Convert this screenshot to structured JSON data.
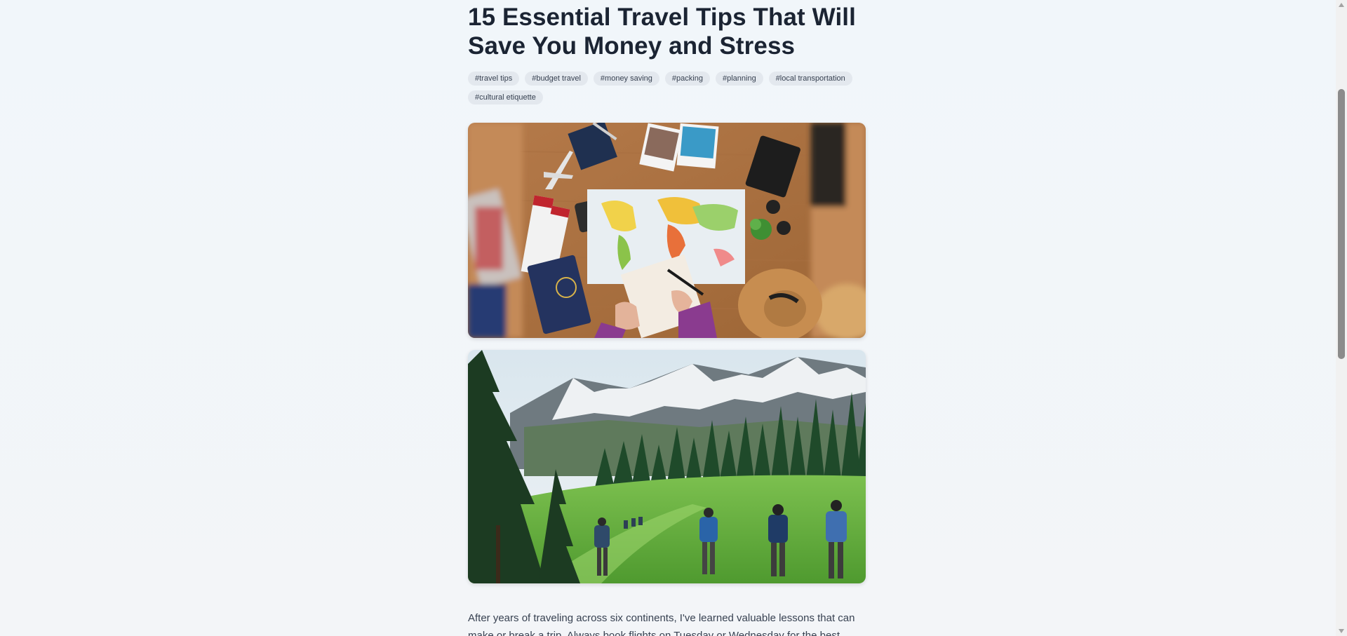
{
  "article": {
    "title": "15 Essential Travel Tips That Will Save You Money and Stress",
    "tags": [
      "#travel tips",
      "#budget travel",
      "#money saving",
      "#packing",
      "#planning",
      "#local transportation",
      "#cultural etiquette"
    ],
    "body_line_1": "After years of traveling across six continents, I've learned valuable lessons that can",
    "body_line_2": "make or break a trip. Always book flights on Tuesday or Wednesday for the best"
  },
  "colors": {
    "title": "#1b2433",
    "tag_bg": "#e3e8ee",
    "page_bg": "#f1f6fa"
  }
}
